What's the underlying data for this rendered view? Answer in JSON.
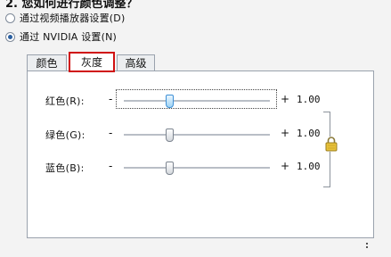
{
  "heading": "2. 您如何进行颜色调整？",
  "options": [
    {
      "label": "通过视频播放器设置(D)",
      "checked": false
    },
    {
      "label": "通过 NVIDIA 设置(N)",
      "checked": true
    }
  ],
  "tabs": [
    {
      "label": "颜色"
    },
    {
      "label": "灰度",
      "active": true
    },
    {
      "label": "高级"
    }
  ],
  "sliders": [
    {
      "label": "红色(R):",
      "minus": "-",
      "plus": "+",
      "value": "1.00",
      "level": 0.3
    },
    {
      "label": "绿色(G):",
      "minus": "-",
      "plus": "+",
      "value": "1.00",
      "level": 0.3
    },
    {
      "label": "蓝色(B):",
      "minus": "-",
      "plus": "+",
      "value": "1.00",
      "level": 0.3
    }
  ],
  "lock_icon": "lock-icon",
  "colors": {
    "tab_highlight": "#d01010",
    "thumb_focus": "#3d8fd6",
    "lock": "#e8c23a"
  }
}
